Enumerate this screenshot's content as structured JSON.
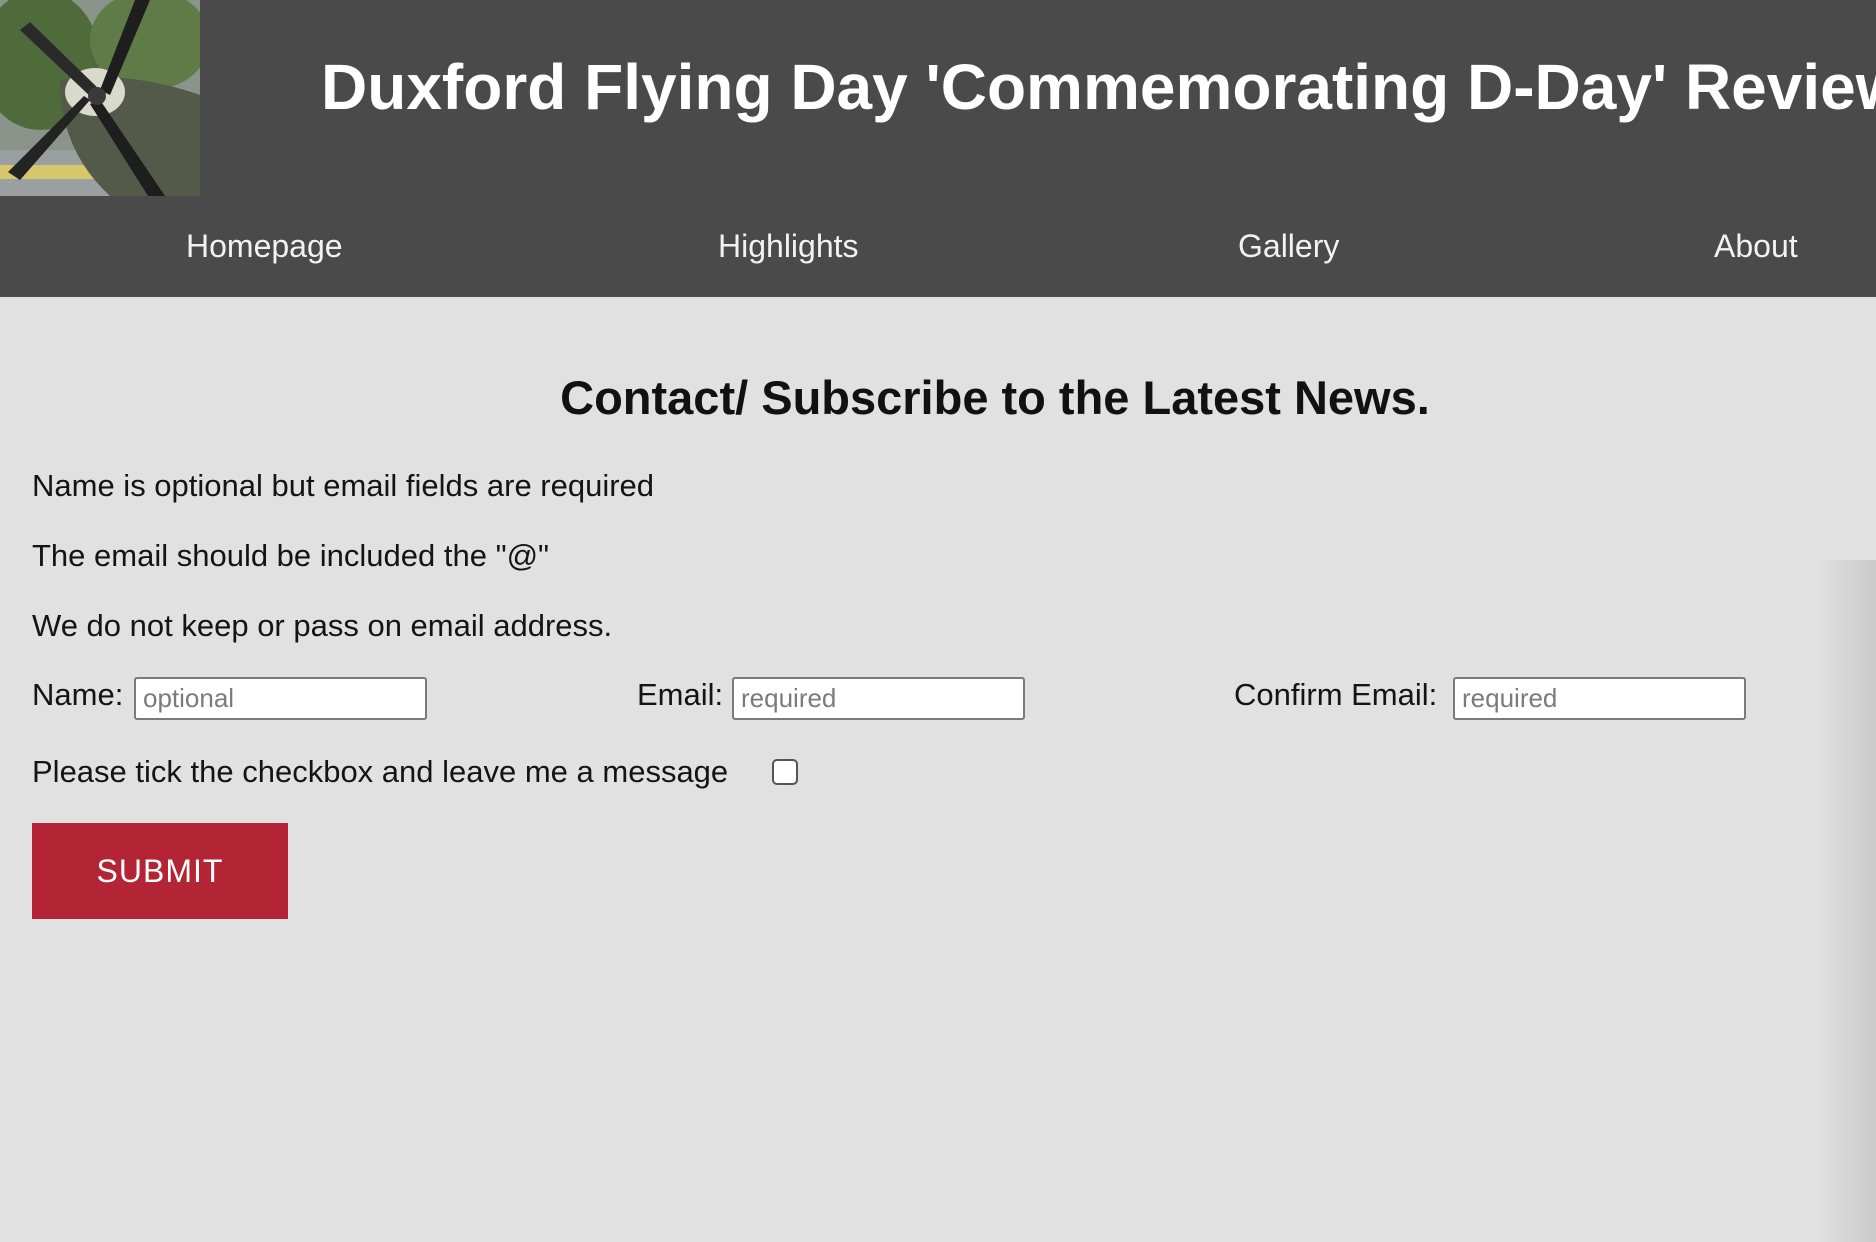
{
  "header": {
    "title": "Duxford Flying Day 'Commemorating D-Day' Review",
    "logo_icon": "spitfire-propeller-photo",
    "background_color": "#4a4a4a"
  },
  "nav": {
    "items": [
      {
        "label": "Homepage"
      },
      {
        "label": "Highlights"
      },
      {
        "label": "Gallery"
      },
      {
        "label": "About"
      }
    ]
  },
  "main": {
    "heading": "Contact/ Subscribe to the Latest News.",
    "notes": [
      "Name is optional but email fields are required",
      "The email should be included the \"@\"",
      "We do not keep or pass on email address."
    ],
    "form": {
      "name_label": "Name:",
      "name_placeholder": "optional",
      "name_value": "",
      "email_label": "Email:",
      "email_placeholder": "required",
      "email_value": "",
      "confirm_label": "Confirm Email:",
      "confirm_placeholder": "required",
      "confirm_value": "",
      "checkbox_label": "Please tick the checkbox and leave me a message",
      "checkbox_checked": false,
      "submit_label": "SUBMIT",
      "submit_color": "#b32435"
    }
  },
  "colors": {
    "page_background": "#e0e1e0",
    "nav_text": "#f2f2f2"
  }
}
